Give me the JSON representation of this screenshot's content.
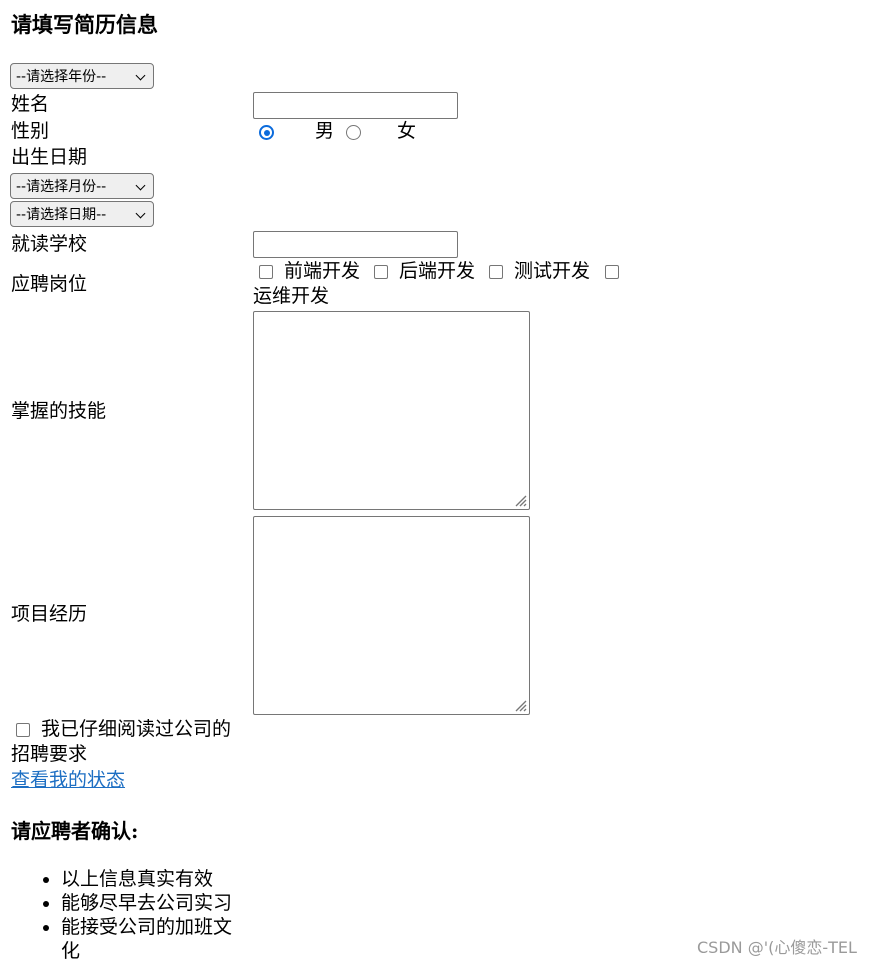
{
  "title": "请填写简历信息",
  "form": {
    "year_select": "--请选择年份--",
    "name_label": "姓名",
    "name_value": "",
    "gender_label": "性别",
    "gender_options": [
      "男",
      "女"
    ],
    "gender_selected": "男",
    "birth_label": "出生日期",
    "month_select": "--请选择月份--",
    "day_select": "--请选择日期--",
    "school_label": "就读学校",
    "school_value": "",
    "position_label": "应聘岗位",
    "positions": [
      "前端开发",
      "后端开发",
      "测试开发",
      "运维开发"
    ],
    "skills_label": "掌握的技能",
    "skills_value": "",
    "projects_label": "项目经历",
    "projects_value": "",
    "agree_line1": "我已仔细阅读过公司的",
    "agree_line2": "招聘要求",
    "status_link": "查看我的状态"
  },
  "confirm": {
    "heading": "请应聘者确认:",
    "items": [
      "以上信息真实有效",
      "能够尽早去公司实习",
      "能接受公司的加班文",
      "化"
    ]
  },
  "watermark": "CSDN @'(心傻恋-TEL"
}
